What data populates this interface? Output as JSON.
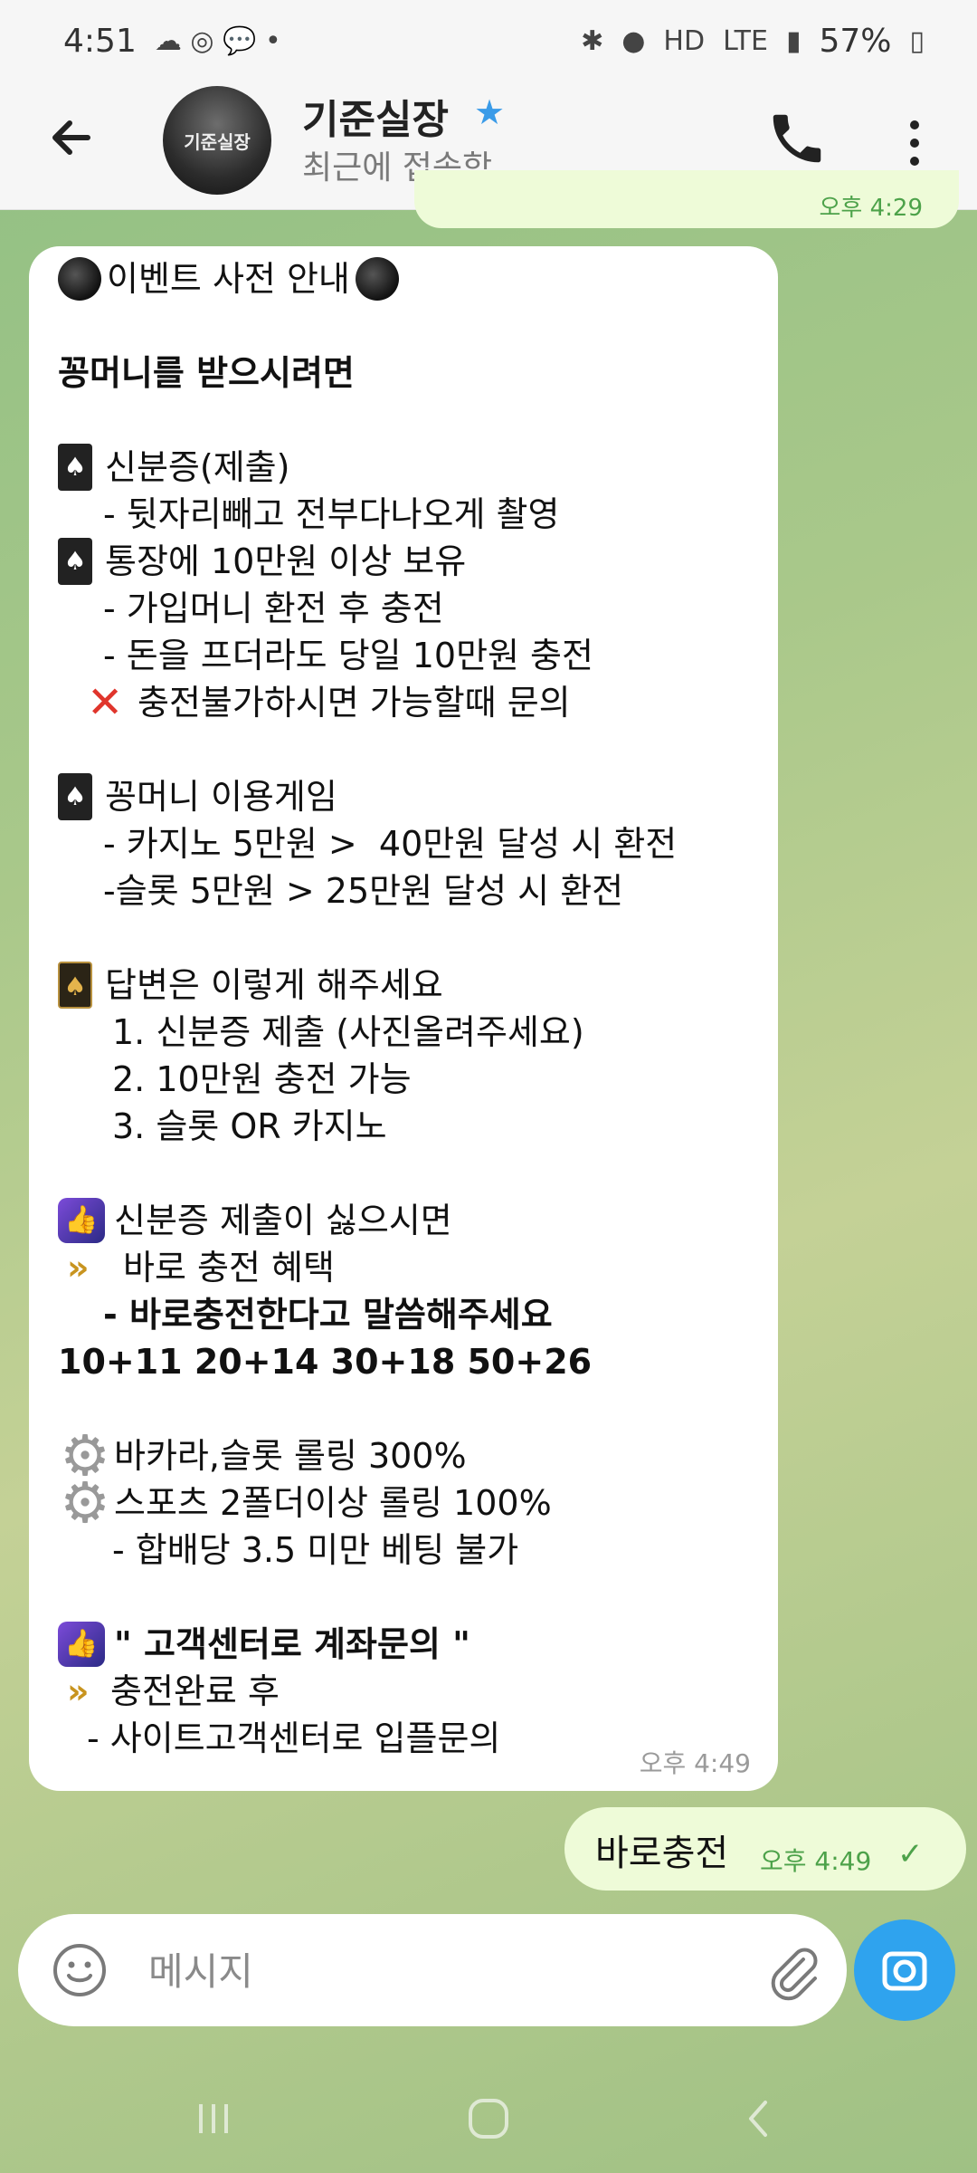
{
  "status_bar": {
    "time": "4:51",
    "battery": "57%",
    "network_hd": "HD",
    "network_lte": "LTE"
  },
  "header": {
    "name": "기준실장",
    "status": "최근에 접속함",
    "avatar_text": "기준실장"
  },
  "previous_message_time": "오후 4:29",
  "incoming_message": {
    "time": "오후 4:49",
    "lines": {
      "l1": "이벤트 사전 안내",
      "l2": "꽁머니를 받으시려면",
      "l3": "신분증(제출)",
      "l4": "- 뒷자리빼고 전부다나오게 촬영",
      "l5": "통장에 10만원 이상 보유",
      "l6": "- 가입머니 환전 후 충전",
      "l7": "- 돈을 프더라도 당일 10만원 충전",
      "l8": "충전불가하시면 가능할때 문의",
      "l9": "꽁머니 이용게임",
      "l10": "- 카지노 5만원 >  40만원 달성 시 환전",
      "l11": "-슬롯 5만원 > 25만원 달성 시 환전",
      "l12": "답변은 이렇게 해주세요",
      "l13": "1. 신분증 제출 (사진올려주세요)",
      "l14": "2. 10만원 충전 가능",
      "l15": "3. 슬롯 OR 카지노",
      "l16": "신분증 제출이 싫으시면",
      "l17": "바로 충전 혜택",
      "l18": "- 바로충전한다고 말씀해주세요",
      "l19": "10+11 20+14 30+18 50+26",
      "l20": "바카라,슬롯 롤링 300%",
      "l21": "스포츠 2폴더이상 롤링 100%",
      "l22": "- 합배당 3.5 미만 베팅 불가",
      "l23": "\" 고객센터로 계좌문의 \"",
      "l24": "충전완료 후",
      "l25": "- 사이트고객센터로 입플문의"
    }
  },
  "outgoing_message": {
    "text": "바로충전",
    "time": "오후 4:49",
    "status_icon": "single-check-icon"
  },
  "input": {
    "placeholder": "메시지"
  },
  "colors": {
    "accent_blue": "#2fa3ee",
    "outgoing_bubble": "#eefbd8",
    "time_green": "#4da24a",
    "verified_blue": "#3a9be8"
  }
}
